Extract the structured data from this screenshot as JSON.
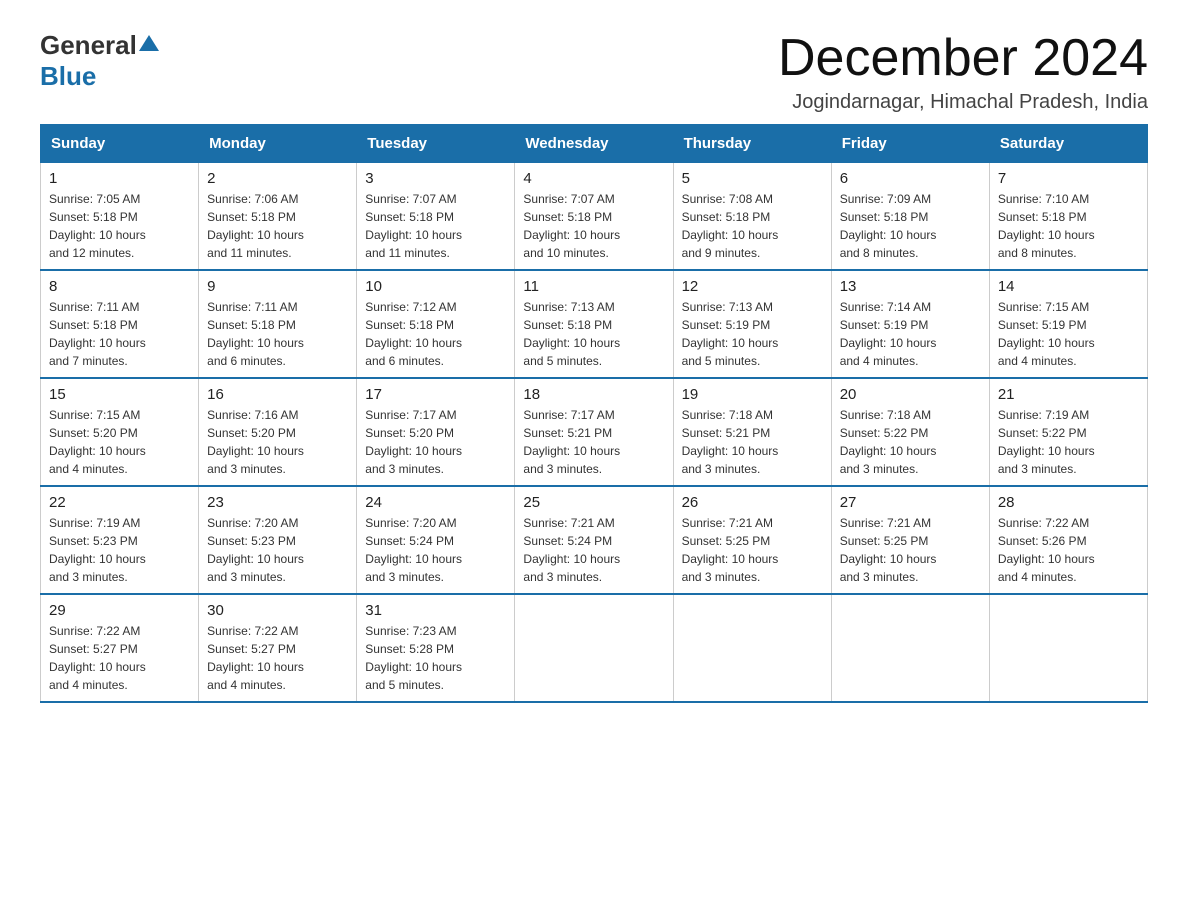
{
  "header": {
    "logo_general": "General",
    "logo_blue": "Blue",
    "month_title": "December 2024",
    "subtitle": "Jogindarnagar, Himachal Pradesh, India"
  },
  "weekdays": [
    "Sunday",
    "Monday",
    "Tuesday",
    "Wednesday",
    "Thursday",
    "Friday",
    "Saturday"
  ],
  "weeks": [
    [
      {
        "day": "1",
        "sunrise": "7:05 AM",
        "sunset": "5:18 PM",
        "daylight": "10 hours and 12 minutes."
      },
      {
        "day": "2",
        "sunrise": "7:06 AM",
        "sunset": "5:18 PM",
        "daylight": "10 hours and 11 minutes."
      },
      {
        "day": "3",
        "sunrise": "7:07 AM",
        "sunset": "5:18 PM",
        "daylight": "10 hours and 11 minutes."
      },
      {
        "day": "4",
        "sunrise": "7:07 AM",
        "sunset": "5:18 PM",
        "daylight": "10 hours and 10 minutes."
      },
      {
        "day": "5",
        "sunrise": "7:08 AM",
        "sunset": "5:18 PM",
        "daylight": "10 hours and 9 minutes."
      },
      {
        "day": "6",
        "sunrise": "7:09 AM",
        "sunset": "5:18 PM",
        "daylight": "10 hours and 8 minutes."
      },
      {
        "day": "7",
        "sunrise": "7:10 AM",
        "sunset": "5:18 PM",
        "daylight": "10 hours and 8 minutes."
      }
    ],
    [
      {
        "day": "8",
        "sunrise": "7:11 AM",
        "sunset": "5:18 PM",
        "daylight": "10 hours and 7 minutes."
      },
      {
        "day": "9",
        "sunrise": "7:11 AM",
        "sunset": "5:18 PM",
        "daylight": "10 hours and 6 minutes."
      },
      {
        "day": "10",
        "sunrise": "7:12 AM",
        "sunset": "5:18 PM",
        "daylight": "10 hours and 6 minutes."
      },
      {
        "day": "11",
        "sunrise": "7:13 AM",
        "sunset": "5:18 PM",
        "daylight": "10 hours and 5 minutes."
      },
      {
        "day": "12",
        "sunrise": "7:13 AM",
        "sunset": "5:19 PM",
        "daylight": "10 hours and 5 minutes."
      },
      {
        "day": "13",
        "sunrise": "7:14 AM",
        "sunset": "5:19 PM",
        "daylight": "10 hours and 4 minutes."
      },
      {
        "day": "14",
        "sunrise": "7:15 AM",
        "sunset": "5:19 PM",
        "daylight": "10 hours and 4 minutes."
      }
    ],
    [
      {
        "day": "15",
        "sunrise": "7:15 AM",
        "sunset": "5:20 PM",
        "daylight": "10 hours and 4 minutes."
      },
      {
        "day": "16",
        "sunrise": "7:16 AM",
        "sunset": "5:20 PM",
        "daylight": "10 hours and 3 minutes."
      },
      {
        "day": "17",
        "sunrise": "7:17 AM",
        "sunset": "5:20 PM",
        "daylight": "10 hours and 3 minutes."
      },
      {
        "day": "18",
        "sunrise": "7:17 AM",
        "sunset": "5:21 PM",
        "daylight": "10 hours and 3 minutes."
      },
      {
        "day": "19",
        "sunrise": "7:18 AM",
        "sunset": "5:21 PM",
        "daylight": "10 hours and 3 minutes."
      },
      {
        "day": "20",
        "sunrise": "7:18 AM",
        "sunset": "5:22 PM",
        "daylight": "10 hours and 3 minutes."
      },
      {
        "day": "21",
        "sunrise": "7:19 AM",
        "sunset": "5:22 PM",
        "daylight": "10 hours and 3 minutes."
      }
    ],
    [
      {
        "day": "22",
        "sunrise": "7:19 AM",
        "sunset": "5:23 PM",
        "daylight": "10 hours and 3 minutes."
      },
      {
        "day": "23",
        "sunrise": "7:20 AM",
        "sunset": "5:23 PM",
        "daylight": "10 hours and 3 minutes."
      },
      {
        "day": "24",
        "sunrise": "7:20 AM",
        "sunset": "5:24 PM",
        "daylight": "10 hours and 3 minutes."
      },
      {
        "day": "25",
        "sunrise": "7:21 AM",
        "sunset": "5:24 PM",
        "daylight": "10 hours and 3 minutes."
      },
      {
        "day": "26",
        "sunrise": "7:21 AM",
        "sunset": "5:25 PM",
        "daylight": "10 hours and 3 minutes."
      },
      {
        "day": "27",
        "sunrise": "7:21 AM",
        "sunset": "5:25 PM",
        "daylight": "10 hours and 3 minutes."
      },
      {
        "day": "28",
        "sunrise": "7:22 AM",
        "sunset": "5:26 PM",
        "daylight": "10 hours and 4 minutes."
      }
    ],
    [
      {
        "day": "29",
        "sunrise": "7:22 AM",
        "sunset": "5:27 PM",
        "daylight": "10 hours and 4 minutes."
      },
      {
        "day": "30",
        "sunrise": "7:22 AM",
        "sunset": "5:27 PM",
        "daylight": "10 hours and 4 minutes."
      },
      {
        "day": "31",
        "sunrise": "7:23 AM",
        "sunset": "5:28 PM",
        "daylight": "10 hours and 5 minutes."
      },
      null,
      null,
      null,
      null
    ]
  ],
  "labels": {
    "sunrise": "Sunrise:",
    "sunset": "Sunset:",
    "daylight": "Daylight:"
  }
}
